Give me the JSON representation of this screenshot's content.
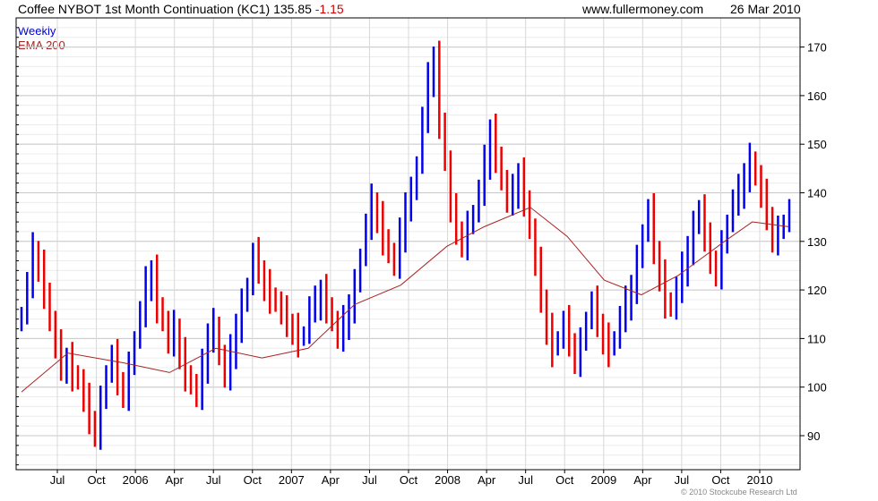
{
  "header": {
    "title": "Coffee NYBOT 1st Month Continuation (KC1)",
    "last": "135.85",
    "change": "-1.15",
    "website": "www.fullermoney.com",
    "date": "26 Mar 2010"
  },
  "copyright": "© 2010 Stockcube Research Ltd",
  "colors": {
    "up": "#0000ee",
    "down": "#ee0000",
    "ema": "#aa2222",
    "grid": "#dddddd"
  },
  "chart_data": {
    "type": "line",
    "legend": [
      "Weekly",
      "EMA 200"
    ],
    "legend_placement": "top-left",
    "ylim": [
      83,
      176
    ],
    "y_ticks": [
      90,
      100,
      110,
      120,
      130,
      140,
      150,
      160,
      170
    ],
    "x_ticks": [
      "Jul",
      "Oct",
      "2006",
      "Apr",
      "Jul",
      "Oct",
      "2007",
      "Apr",
      "Jul",
      "Oct",
      "2008",
      "Apr",
      "Jul",
      "Oct",
      "2009",
      "Apr",
      "Jul",
      "Oct",
      "2010"
    ],
    "grid": true,
    "series": [
      {
        "name": "Weekly",
        "close_series": [
          115,
          121,
          128,
          125,
          120,
          113,
          108,
          104,
          106,
          103,
          101,
          97,
          93,
          91,
          97,
          103,
          106,
          101,
          99,
          104,
          110,
          115,
          121,
          124,
          117,
          113,
          109,
          112,
          107,
          103,
          100,
          98,
          104,
          111,
          113,
          106,
          102,
          107,
          113,
          117,
          121,
          127,
          124,
          121,
          119,
          117,
          115,
          113,
          112,
          110,
          111,
          116,
          117,
          120,
          117,
          113,
          110,
          113,
          117,
          121,
          127,
          133,
          138,
          135,
          131,
          127,
          125,
          131,
          138,
          140,
          146,
          155,
          163,
          168,
          155,
          146,
          136,
          132,
          130,
          133,
          136,
          140,
          146,
          153,
          148,
          142,
          138,
          140,
          144,
          139,
          132,
          125,
          118,
          112,
          108,
          110,
          113,
          109,
          106,
          109,
          114,
          117,
          113,
          110,
          108,
          110,
          114,
          117,
          121,
          126,
          132,
          136,
          128,
          123,
          118,
          116,
          120,
          124,
          129,
          133,
          137,
          130,
          126,
          124,
          129,
          134,
          138,
          140,
          144,
          147,
          143,
          139,
          135,
          131,
          132,
          134,
          136
        ]
      },
      {
        "name": "EMA 200",
        "points": [
          [
            0,
            99
          ],
          [
            10,
            107
          ],
          [
            22,
            105
          ],
          [
            32,
            103
          ],
          [
            42,
            108
          ],
          [
            52,
            106
          ],
          [
            62,
            108
          ],
          [
            72,
            117
          ],
          [
            82,
            121
          ],
          [
            92,
            129
          ],
          [
            100,
            133
          ],
          [
            110,
            137
          ],
          [
            118,
            131
          ],
          [
            126,
            122
          ],
          [
            134,
            119
          ],
          [
            142,
            123
          ],
          [
            152,
            130
          ],
          [
            158,
            134
          ],
          [
            166,
            133
          ]
        ]
      }
    ]
  }
}
